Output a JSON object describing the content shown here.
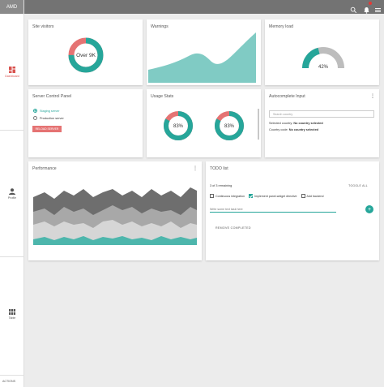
{
  "app": {
    "brand": "AMD"
  },
  "nav": {
    "items": [
      {
        "label": "Dashboard",
        "icon": "dashboard-icon"
      },
      {
        "label": "Profile",
        "icon": "person-icon"
      },
      {
        "label": "Table",
        "icon": "table-icon"
      }
    ],
    "actions_label": "ACTIONS"
  },
  "toolbar": {
    "icons": [
      "search-icon",
      "notifications-icon",
      "menu-icon"
    ]
  },
  "cards": {
    "site_visitors": {
      "title": "Site visitors",
      "value": "Over 9K",
      "fraction": 0.75
    },
    "warnings": {
      "title": "Warnings"
    },
    "memory_load": {
      "title": "Memory load",
      "value": "42%",
      "fraction": 0.42
    },
    "server_panel": {
      "title": "Server Control Panel",
      "options": [
        "Staging server",
        "Production server"
      ],
      "selected": "Staging server",
      "button": "RELOAD SERVER"
    },
    "usage_stats": {
      "title": "Usage Stats",
      "gauges": [
        {
          "value": "83%",
          "fraction": 0.83
        },
        {
          "value": "83%",
          "fraction": 0.83
        }
      ]
    },
    "autocomplete": {
      "title": "Autocomplete Input",
      "placeholder": "Search country",
      "selected_country_label": "Selected country:",
      "selected_country_value": "No country selected",
      "country_code_label": "Country code:",
      "country_code_value": "No country selected"
    },
    "performance": {
      "title": "Performance"
    },
    "todo": {
      "title": "TODO list",
      "remaining": "3 of 3 remaining",
      "toggle_all": "TOGGLE ALL",
      "items": [
        {
          "label": "Continuous integration",
          "done": false
        },
        {
          "label": "Implement panel-widget directive",
          "done": true
        },
        {
          "label": "Add backend",
          "done": false
        }
      ],
      "input_placeholder": "Write some text task here",
      "remove_completed": "REMOVE COMPLETED"
    }
  },
  "colors": {
    "teal": "#26a69a",
    "red": "#e57373",
    "gray": "#b0b0b0",
    "toolbar": "#737373"
  }
}
